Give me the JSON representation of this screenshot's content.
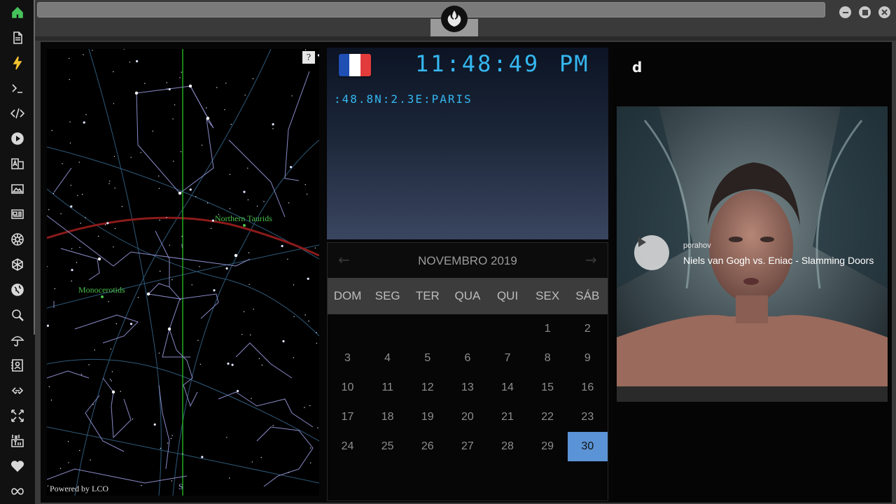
{
  "sidebar": {
    "items": [
      {
        "icon": "home-icon"
      },
      {
        "icon": "document-icon"
      },
      {
        "icon": "lightning-icon"
      },
      {
        "icon": "terminal-icon"
      },
      {
        "icon": "code-icon"
      },
      {
        "icon": "play-icon"
      },
      {
        "icon": "translate-icon"
      },
      {
        "icon": "image-icon"
      },
      {
        "icon": "newspaper-icon"
      },
      {
        "icon": "empire-icon"
      },
      {
        "icon": "hexagon-icon"
      },
      {
        "icon": "globe-icon"
      },
      {
        "icon": "search-icon"
      },
      {
        "icon": "umbrella-icon"
      },
      {
        "icon": "contact-icon"
      },
      {
        "icon": "link-icon"
      },
      {
        "icon": "expand-icon"
      },
      {
        "icon": "youtube-icon"
      },
      {
        "icon": "heart-icon"
      },
      {
        "icon": "infinity-icon"
      }
    ],
    "active_color": "#46c25a"
  },
  "skymap": {
    "help_label": "?",
    "label_northern_taurids": "Northern Taurids",
    "label_monocerotids": "Monocerotids",
    "powered_by": "Powered by LCO",
    "south_label": "S",
    "ecliptic_color": "#8b1a1a",
    "meridian_color": "#22aa22"
  },
  "clock": {
    "time": "11:48:49",
    "ampm": "PM",
    "location": ":48.8N:2.3E:PARIS",
    "flag_colors": [
      "#1f4fb3",
      "#ffffff",
      "#e23b3b"
    ],
    "digit_color": "#35b7f0"
  },
  "calendar": {
    "prev_label": "←",
    "next_label": "→",
    "title": "NOVEMBRO 2019",
    "day_names": [
      "DOM",
      "SEG",
      "TER",
      "QUA",
      "QUI",
      "SEX",
      "SÁB"
    ],
    "first_weekday": 5,
    "days_in_month": 30,
    "selected_day": 30,
    "selected_color": "#5b94d6"
  },
  "rightpanel": {
    "logo_text": "d",
    "video": {
      "uploader": "porahov",
      "title": "Niels van Gogh vs. Eniac - Slamming Doors"
    }
  }
}
